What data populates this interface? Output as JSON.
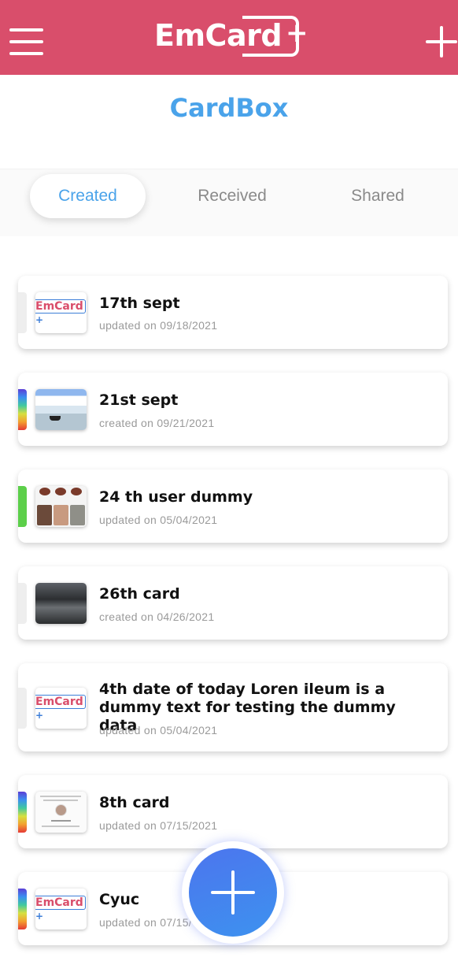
{
  "header": {
    "brand": "EmCard",
    "brand_plus": "+",
    "color": "#d94e6b"
  },
  "page": {
    "title": "CardBox",
    "accent": "#4aa3ea"
  },
  "tabs": [
    {
      "label": "Created",
      "active": true
    },
    {
      "label": "Received",
      "active": false
    },
    {
      "label": "Shared",
      "active": false
    }
  ],
  "cards": [
    {
      "title": "17th sept",
      "subtitle": "updated on 09/18/2021",
      "thumb": "emcard-logo",
      "stripe": "grey"
    },
    {
      "title": "21st sept",
      "subtitle": "created on 09/21/2021",
      "thumb": "screenshot",
      "stripe": "rainbow"
    },
    {
      "title": "24 th user dummy",
      "subtitle": "updated on 05/04/2021",
      "thumb": "screenshot",
      "stripe": "green"
    },
    {
      "title": "26th card",
      "subtitle": "created on 04/26/2021",
      "thumb": "photo",
      "stripe": "grey"
    },
    {
      "title": "4th date of today Loren ileum is a dummy text for testing the dummy data",
      "subtitle": "updated on 05/04/2021",
      "thumb": "emcard-logo",
      "stripe": "grey"
    },
    {
      "title": "8th card",
      "subtitle": "updated on 07/15/2021",
      "thumb": "profile",
      "stripe": "rainbow"
    },
    {
      "title": "Cyuc",
      "subtitle": "updated on 07/15/",
      "thumb": "emcard-logo",
      "stripe": "rainbow"
    }
  ],
  "thumb_logo": {
    "text": "EmCard",
    "plus": "+"
  },
  "fab": {
    "icon": "plus-icon",
    "color": "#4c75ee"
  }
}
